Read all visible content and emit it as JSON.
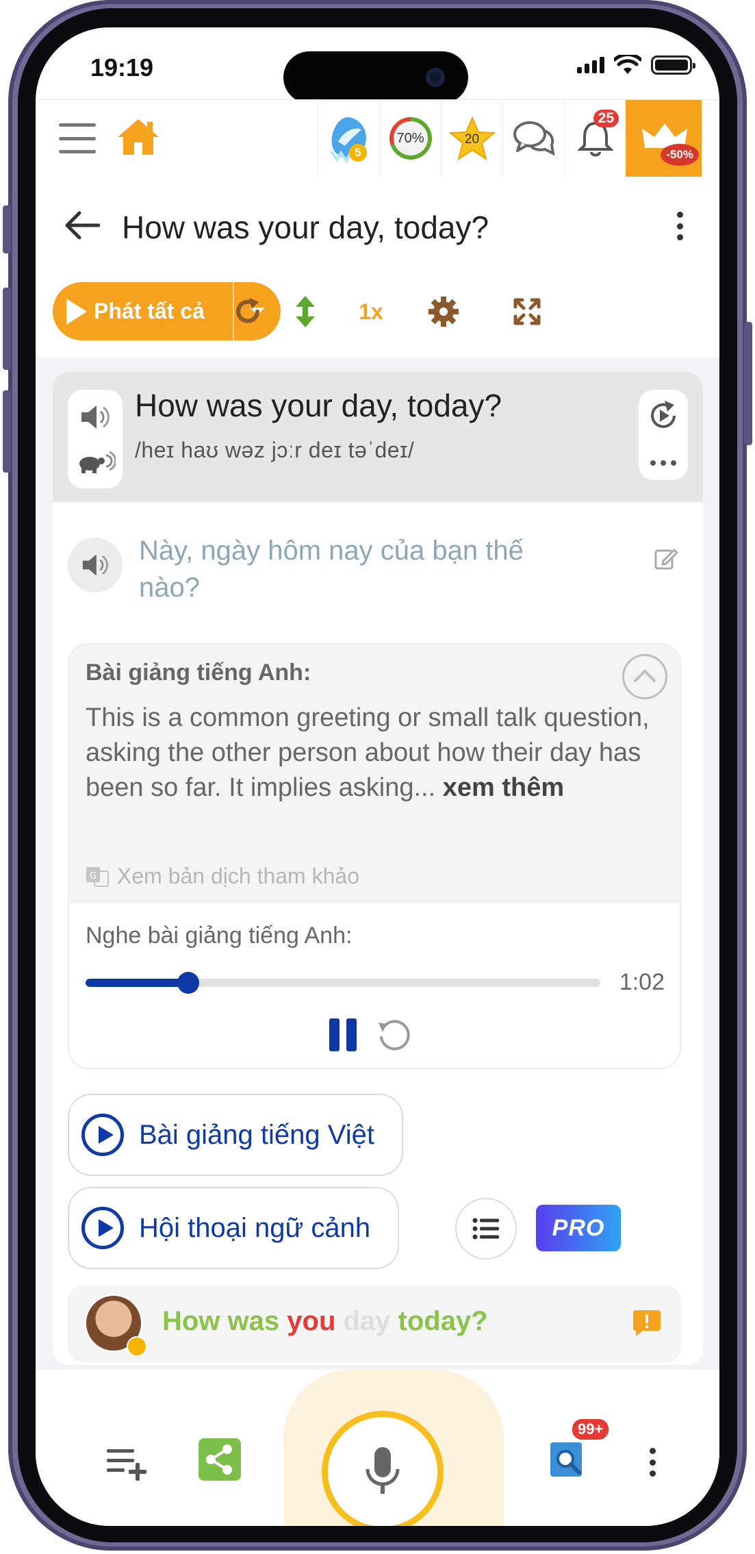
{
  "status": {
    "time": "19:19"
  },
  "topbar": {
    "level_badge": "5",
    "progress_percent": "70%",
    "stars_count": "20",
    "notifications_count": "25",
    "promo_discount": "-50%"
  },
  "header": {
    "title": "How was your day, today?"
  },
  "toolbar": {
    "play_all_label": "Phát tất cả",
    "speed_label": "1x"
  },
  "sentence": {
    "text": "How was your day, today?",
    "ipa": "/heɪ haʊ wəz jɔːr deɪ təˈdeɪ/",
    "translation": "Này, ngày hôm nay của bạn thế nào?"
  },
  "lecture": {
    "heading": "Bài giảng tiếng Anh:",
    "body": "This is a common greeting or small talk question, asking the other person about how their day has been so far. It implies asking...",
    "see_more": "xem thêm",
    "view_translation": "Xem bản dịch tham khảo",
    "listen_label": "Nghe bài giảng tiếng Anh:",
    "duration": "1:02",
    "progress": 0.2
  },
  "buttons": {
    "vietnamese_lecture": "Bài giảng tiếng Việt",
    "context_dialog": "Hội thoại ngữ cảnh",
    "pro_label": "PRO"
  },
  "dialog": {
    "words": [
      {
        "text": "How was ",
        "state": "correct"
      },
      {
        "text": "you",
        "state": "wrong"
      },
      {
        "text": " day ",
        "state": "missing"
      },
      {
        "text": "today?",
        "state": "correct"
      }
    ]
  },
  "bottom": {
    "dictionary_badge": "99+"
  },
  "colors": {
    "accent_orange": "#f6a21e",
    "primary_blue": "#0f3aa5",
    "correct_green": "#8bc34a",
    "wrong_red": "#e53935",
    "translation_gray_blue": "#8ca6b6"
  }
}
